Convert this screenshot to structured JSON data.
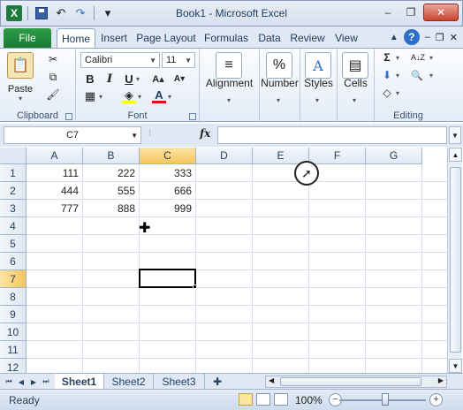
{
  "window": {
    "title": "Book1 - Microsoft Excel",
    "logo": "X",
    "minimize": "‒",
    "restore": "❐",
    "close": "✕",
    "undo": "↶",
    "redo": "↷",
    "customize": "▾"
  },
  "tabs": {
    "file": "File",
    "home": "Home",
    "insert": "Insert",
    "page_layout": "Page Layout",
    "formulas": "Formulas",
    "data": "Data",
    "review": "Review",
    "view": "View",
    "help": "?"
  },
  "ribbon": {
    "clipboard": {
      "label": "Clipboard",
      "paste": "Paste",
      "cut": "✂",
      "copy": "⧉",
      "format_painter": "🖌"
    },
    "font": {
      "label": "Font",
      "name": "Calibri",
      "size": "11",
      "bold": "B",
      "italic": "I",
      "underline": "U",
      "grow": "A▴",
      "shrink": "A▾",
      "borders": "▦",
      "fill": "◈",
      "font_color": "A"
    },
    "alignment": {
      "label": "Alignment"
    },
    "number": {
      "label": "Number",
      "icon": "%"
    },
    "styles": {
      "label": "Styles",
      "icon": "A"
    },
    "cells": {
      "label": "Cells",
      "icon": "▤"
    },
    "editing": {
      "label": "Editing",
      "sum": "Σ",
      "fill": "⬇",
      "clear": "◇",
      "sort": "A↓Z",
      "find": "🔍"
    }
  },
  "formula_bar": {
    "name_box": "C7",
    "fx": "fx",
    "value": ""
  },
  "grid": {
    "columns": [
      "A",
      "B",
      "C",
      "D",
      "E",
      "F",
      "G"
    ],
    "rows": [
      "1",
      "2",
      "3",
      "4",
      "5",
      "6",
      "7",
      "8",
      "9",
      "10",
      "11",
      "12"
    ],
    "cells": {
      "A1": "111",
      "B1": "222",
      "C1": "333",
      "A2": "444",
      "B2": "555",
      "C2": "666",
      "A3": "777",
      "B3": "888",
      "C3": "999"
    },
    "selected_column": "C",
    "selected_row": "7"
  },
  "sheets": [
    "Sheet1",
    "Sheet2",
    "Sheet3"
  ],
  "status": {
    "ready": "Ready",
    "zoom": "100%",
    "zoom_out": "−",
    "zoom_in": "+"
  },
  "colors": {
    "file_tab": "#1b7a33",
    "selection_header": "#f5c55d",
    "header_bg": "#dfe8f4"
  }
}
